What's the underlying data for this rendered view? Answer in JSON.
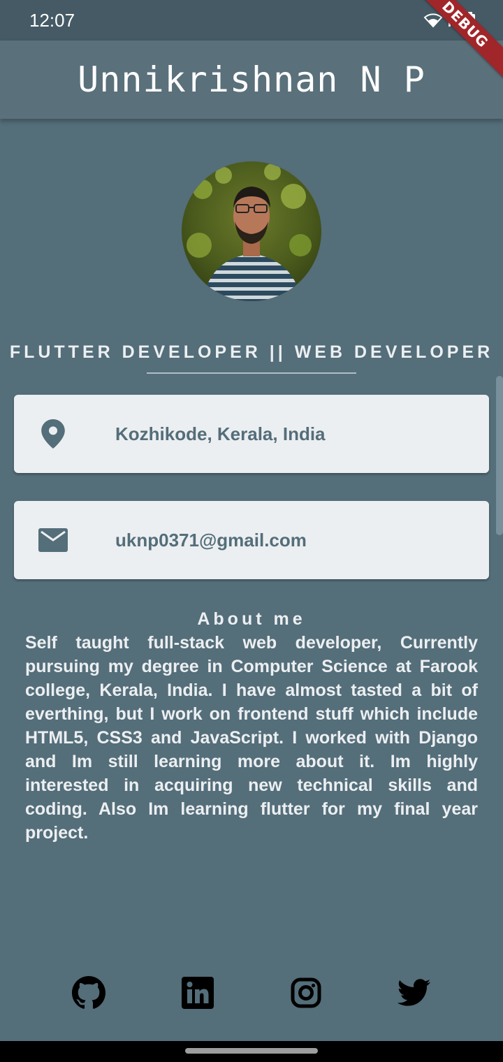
{
  "status_bar": {
    "time": "12:07",
    "icons": [
      "wifi-icon",
      "signal-icon",
      "battery-icon"
    ]
  },
  "debug_banner": "DEBUG",
  "app_bar": {
    "title": "Unnikrishnan N P"
  },
  "profile": {
    "subtitle": "FLUTTER DEVELOPER || WEB DEVELOPER",
    "location": "Kozhikode, Kerala, India",
    "email": "uknp0371@gmail.com"
  },
  "about": {
    "title": "About me",
    "text": "Self taught full-stack web developer, Currently pursuing my degree in Computer Science at Farook college, Kerala, India. I have almost tasted a bit of everthing, but I work on frontend stuff which include HTML5, CSS3 and JavaScript. I worked with Django and Im still learning more about it. Im highly interested in acquiring new technical skills and coding. Also Im learning flutter for my final year project."
  },
  "social": [
    "github-icon",
    "linkedin-icon",
    "instagram-icon",
    "twitter-icon"
  ],
  "colors": {
    "background": "#546e7a",
    "app_bar": "#5a707b",
    "card": "#eceff1",
    "accent_text": "#546e7a"
  }
}
